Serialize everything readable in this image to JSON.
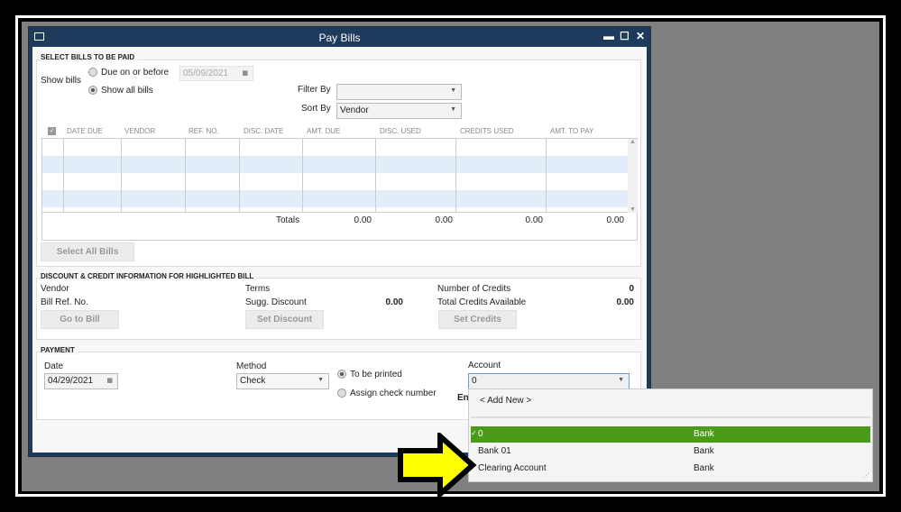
{
  "window": {
    "title": "Pay Bills",
    "menu_icon": "window-menu-icon",
    "minimize": "▬",
    "maximize": "☐",
    "close": "✕"
  },
  "select_bills": {
    "section_title": "SELECT BILLS TO BE PAID",
    "show_bills_label": "Show bills",
    "due_on_or_before": "Due on or before",
    "due_date": "05/09/2021",
    "show_all_bills": "Show all bills",
    "selected_option": "Show all bills",
    "filter_by_label": "Filter By",
    "filter_by_value": "",
    "sort_by_label": "Sort By",
    "sort_by_value": "Vendor",
    "columns": [
      "DATE DUE",
      "VENDOR",
      "REF. NO.",
      "DISC. DATE",
      "AMT. DUE",
      "DISC. USED",
      "CREDITS USED",
      "AMT. TO PAY"
    ],
    "totals_label": "Totals",
    "totals": [
      "0.00",
      "0.00",
      "0.00",
      "0.00"
    ],
    "select_all_button": "Select All Bills"
  },
  "discount_credit": {
    "section_title": "DISCOUNT & CREDIT INFORMATION FOR HIGHLIGHTED BILL",
    "vendor_label": "Vendor",
    "bill_ref_label": "Bill Ref. No.",
    "terms_label": "Terms",
    "sugg_discount_label": "Sugg. Discount",
    "sugg_discount_value": "0.00",
    "num_credits_label": "Number of Credits",
    "num_credits_value": "0",
    "total_credits_label": "Total Credits Available",
    "total_credits_value": "0.00",
    "go_to_bill": "Go to Bill",
    "set_discount": "Set Discount",
    "set_credits": "Set Credits"
  },
  "payment": {
    "section_title": "PAYMENT",
    "date_label": "Date",
    "date_value": "04/29/2021",
    "method_label": "Method",
    "method_value": "Check",
    "to_be_printed": "To be printed",
    "assign_check_number": "Assign check number",
    "selected_option": "To be printed",
    "account_label": "Account",
    "account_value": "0",
    "ending_balance_partial": "En"
  },
  "account_dropdown": {
    "add_new": "< Add New >",
    "items": [
      {
        "name": "0",
        "type": "Bank",
        "selected": true
      },
      {
        "name": "Bank 01",
        "type": "Bank",
        "selected": false
      },
      {
        "name": "Clearing Account",
        "type": "Bank",
        "selected": false
      }
    ],
    "highlight_color": "#4c9a1a"
  },
  "annotation": {
    "arrow_color": "#ffff00"
  }
}
